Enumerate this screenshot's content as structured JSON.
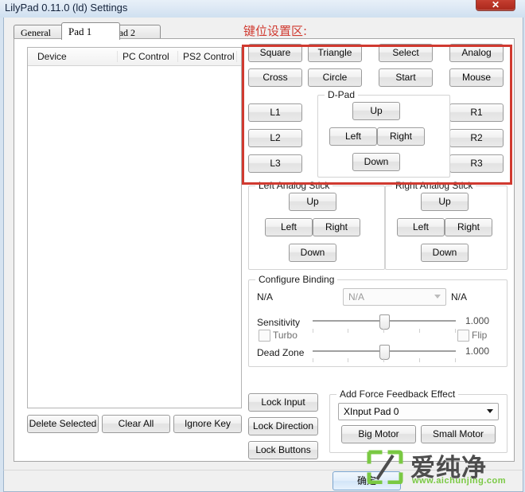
{
  "window": {
    "title": "LilyPad 0.11.0 (ld) Settings",
    "close_label": "✕"
  },
  "tabs": [
    {
      "label": "General",
      "active": false
    },
    {
      "label": "Pad 1",
      "active": true
    },
    {
      "label": "Pad 2",
      "active": false
    }
  ],
  "device_list": {
    "columns": [
      "Device",
      "PC Control",
      "PS2 Control"
    ],
    "rows": []
  },
  "list_buttons": [
    {
      "label": "Delete Selected"
    },
    {
      "label": "Clear All"
    },
    {
      "label": "Ignore Key"
    }
  ],
  "annotation": {
    "text": "键位设置区:",
    "color": "#d03a30"
  },
  "pad_buttons": {
    "column1": [
      "Square",
      "Cross",
      "L1",
      "L2",
      "L3"
    ],
    "column2": [
      "Triangle",
      "Circle"
    ],
    "column3": [
      "Select",
      "Start"
    ],
    "column4": [
      "Analog",
      "Mouse",
      "R1",
      "R2",
      "R3"
    ],
    "dpad": {
      "label": "D-Pad",
      "up": "Up",
      "left": "Left",
      "right": "Right",
      "down": "Down"
    }
  },
  "left_analog": {
    "label": "Left Analog Stick",
    "up": "Up",
    "left": "Left",
    "right": "Right",
    "down": "Down"
  },
  "right_analog": {
    "label": "Right Analog Stick",
    "up": "Up",
    "left": "Left",
    "right": "Right",
    "down": "Down"
  },
  "configure_binding": {
    "label": "Configure Binding",
    "left_value": "N/A",
    "combo_value": "N/A",
    "right_value": "N/A",
    "sensitivity_label": "Sensitivity",
    "sensitivity_value": "1.000",
    "turbo_label": "Turbo",
    "flip_label": "Flip",
    "deadzone_label": "Dead Zone",
    "deadzone_value": "1.000"
  },
  "lock_buttons": [
    {
      "label": "Lock Input"
    },
    {
      "label": "Lock Direction"
    },
    {
      "label": "Lock Buttons"
    }
  ],
  "force_feedback": {
    "label": "Add Force Feedback Effect",
    "device": "XInput Pad 0",
    "big_motor": "Big Motor",
    "small_motor": "Small Motor"
  },
  "footer": {
    "ok_label": "确定"
  },
  "watermark": {
    "brand": "爱纯净",
    "url": "www.aichunjing.com",
    "color": "#7ac943"
  }
}
